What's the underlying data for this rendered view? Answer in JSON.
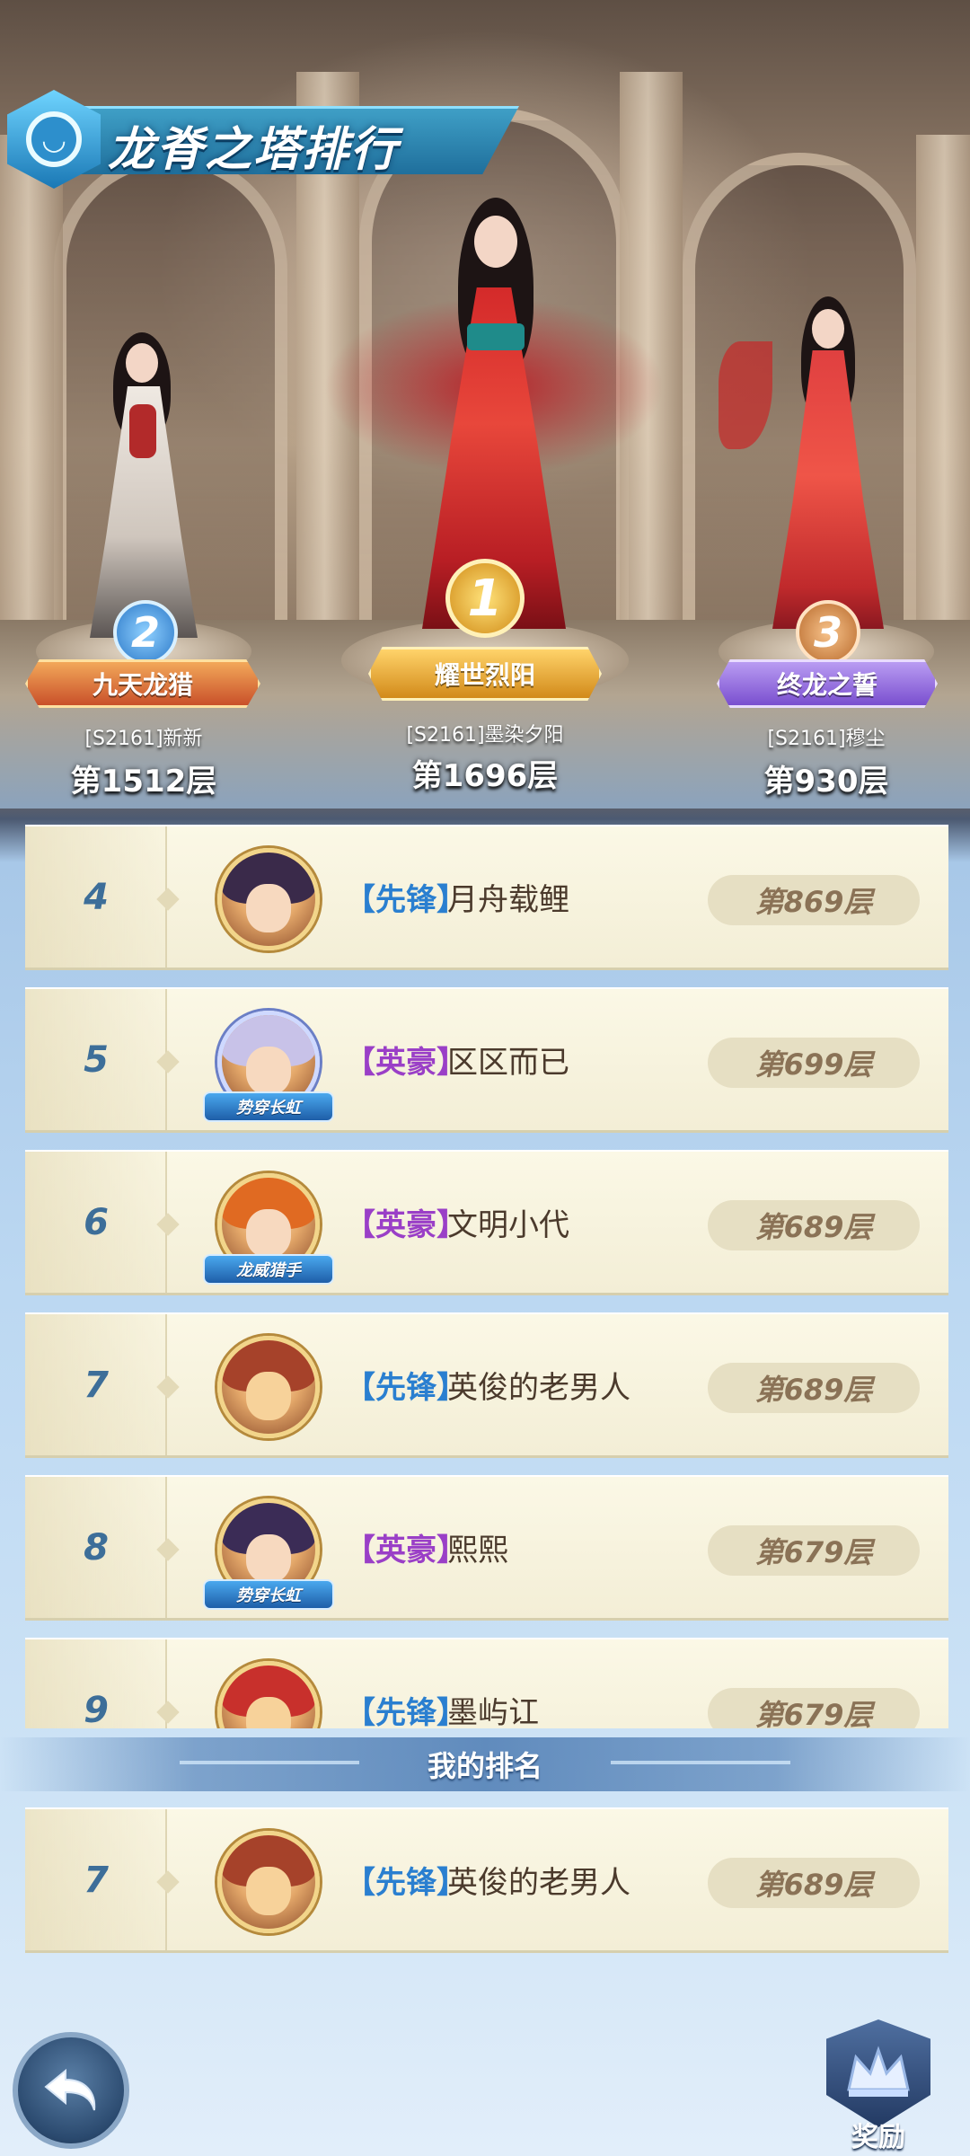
{
  "title": "龙脊之塔排行",
  "podium": [
    {
      "place": "2",
      "title": "九天龙猎",
      "name": "[S2161]新新",
      "floor": "第1512层"
    },
    {
      "place": "1",
      "title": "耀世烈阳",
      "name": "[S2161]墨染夕阳",
      "floor": "第1696层"
    },
    {
      "place": "3",
      "title": "终龙之誓",
      "name": "[S2161]穆尘",
      "floor": "第930层"
    }
  ],
  "ranking": [
    {
      "rank": "4",
      "tag": "【先锋】",
      "name": "月舟载鲤",
      "floor": "第869层",
      "avatar_title": ""
    },
    {
      "rank": "5",
      "tag": "【英豪】",
      "name": "区区而已",
      "floor": "第699层",
      "avatar_title": "势穿长虹"
    },
    {
      "rank": "6",
      "tag": "【英豪】",
      "name": "文明小代",
      "floor": "第689层",
      "avatar_title": "龙威猎手"
    },
    {
      "rank": "7",
      "tag": "【先锋】",
      "name": "英俊的老男人",
      "floor": "第689层",
      "avatar_title": ""
    },
    {
      "rank": "8",
      "tag": "【英豪】",
      "name": "熙熙",
      "floor": "第679层",
      "avatar_title": "势穿长虹"
    },
    {
      "rank": "9",
      "tag": "【先锋】",
      "name": "墨屿讧",
      "floor": "第679层",
      "avatar_title": ""
    }
  ],
  "my_rank_label": "我的排名",
  "my_rank": {
    "rank": "7",
    "tag": "【先锋】",
    "name": "英俊的老男人",
    "floor": "第689层"
  },
  "buttons": {
    "reward": "奖励"
  },
  "colors": {
    "tag_vanguard": "#2a7fd0",
    "tag_hero": "#9a3fc7",
    "rank_number": "#3d6e99",
    "floor_pill": "#e6dfc3"
  }
}
